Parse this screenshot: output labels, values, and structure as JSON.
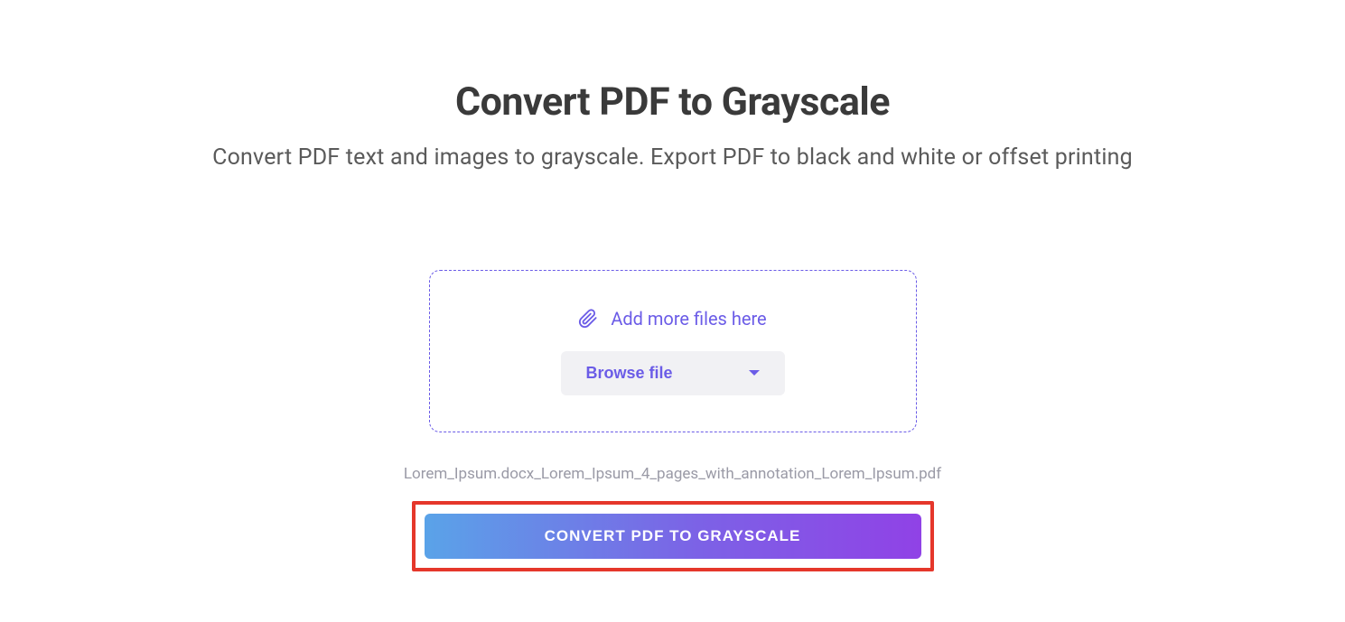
{
  "header": {
    "title": "Convert PDF to Grayscale",
    "subtitle": "Convert PDF text and images to grayscale. Export PDF to black and white or offset printing"
  },
  "upload": {
    "add_more_label": "Add more files here",
    "browse_label": "Browse file"
  },
  "file": {
    "name": "Lorem_Ipsum.docx_Lorem_Ipsum_4_pages_with_annotation_Lorem_Ipsum.pdf"
  },
  "actions": {
    "convert_label": "CONVERT PDF TO GRAYSCALE"
  },
  "colors": {
    "accent": "#6b5ce7",
    "gradient_start": "#5aa3e8",
    "gradient_mid": "#7c62e6",
    "gradient_end": "#9042e6",
    "highlight_border": "#e5372b"
  }
}
